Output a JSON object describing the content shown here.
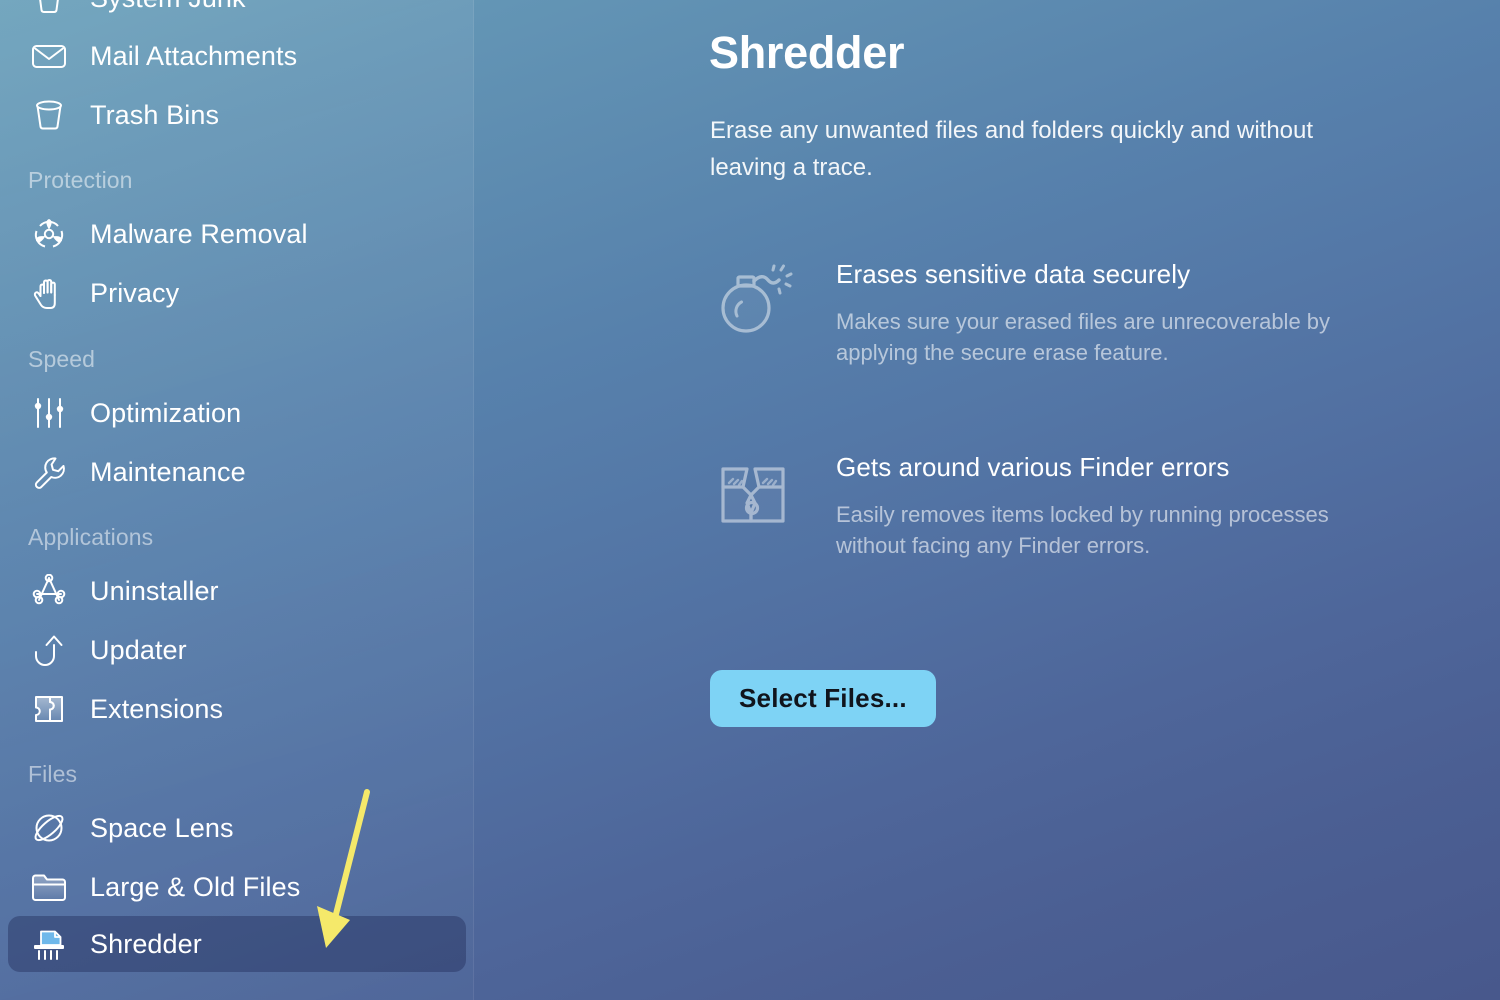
{
  "sidebar": {
    "groups": [
      {
        "label": null,
        "items": [
          {
            "label": "System Junk",
            "icon": "system-junk-icon",
            "selected": false,
            "clipped_top": true
          },
          {
            "label": "Mail Attachments",
            "icon": "mail-attachments-icon",
            "selected": false
          },
          {
            "label": "Trash Bins",
            "icon": "trash-bins-icon",
            "selected": false
          }
        ]
      },
      {
        "label": "Protection",
        "items": [
          {
            "label": "Malware Removal",
            "icon": "biohazard-icon",
            "selected": false
          },
          {
            "label": "Privacy",
            "icon": "hand-icon",
            "selected": false
          }
        ]
      },
      {
        "label": "Speed",
        "items": [
          {
            "label": "Optimization",
            "icon": "sliders-icon",
            "selected": false
          },
          {
            "label": "Maintenance",
            "icon": "wrench-icon",
            "selected": false
          }
        ]
      },
      {
        "label": "Applications",
        "items": [
          {
            "label": "Uninstaller",
            "icon": "app-store-a-icon",
            "selected": false
          },
          {
            "label": "Updater",
            "icon": "up-arrow-curve-icon",
            "selected": false
          },
          {
            "label": "Extensions",
            "icon": "puzzle-piece-icon",
            "selected": false
          }
        ]
      },
      {
        "label": "Files",
        "items": [
          {
            "label": "Space Lens",
            "icon": "planet-icon",
            "selected": false
          },
          {
            "label": "Large & Old Files",
            "icon": "folder-icon",
            "selected": false
          },
          {
            "label": "Shredder",
            "icon": "shredder-icon",
            "selected": true
          }
        ]
      }
    ]
  },
  "main": {
    "title": "Shredder",
    "subtitle": "Erase any unwanted files and folders quickly and without leaving a trace.",
    "features": [
      {
        "icon": "bomb-icon",
        "title": "Erases sensitive data securely",
        "description": "Makes sure your erased files are unrecoverable by applying the secure erase feature."
      },
      {
        "icon": "broken-box-icon",
        "title": "Gets around various Finder errors",
        "description": "Easily removes items locked by running processes without facing any Finder errors."
      }
    ],
    "primary_button": "Select Files..."
  },
  "annotation": {
    "type": "arrow",
    "color": "#f5e96a",
    "points_to": "Shredder"
  },
  "colors": {
    "accent_button": "#7ed3f5",
    "button_text": "#10141c",
    "sidebar_selected": "#4a5578",
    "bg_top": "#69a0ba",
    "bg_bottom": "#48588c",
    "annotation_yellow": "#f5e96a"
  }
}
